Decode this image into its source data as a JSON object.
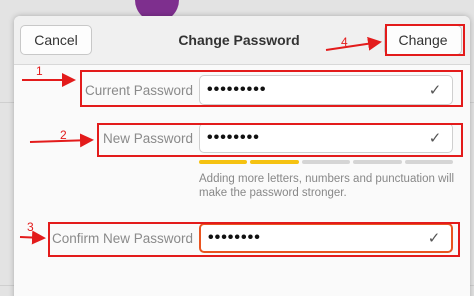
{
  "dialog": {
    "title": "Change Password",
    "cancel_label": "Cancel",
    "change_label": "Change"
  },
  "fields": {
    "current": {
      "label": "Current Password",
      "value": "•••••••••"
    },
    "new": {
      "label": "New Password",
      "value": "••••••••"
    },
    "confirm": {
      "label": "Confirm New Password",
      "value": "••••••••"
    }
  },
  "strength": {
    "filled_segments": 2,
    "total_segments": 5
  },
  "hint": "Adding more letters, numbers and punctuation will make the password stronger.",
  "annotations": {
    "n1": "1",
    "n2": "2",
    "n3": "3",
    "n4": "4"
  },
  "colors": {
    "annotation": "#e31b1b",
    "focus": "#e95420",
    "strength": "#f5c211",
    "avatar": "#7e2f8e"
  },
  "icons": {
    "field_check": "check-icon"
  }
}
